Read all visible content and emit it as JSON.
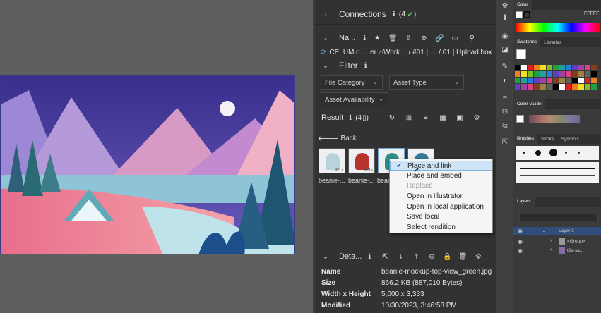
{
  "celum": {
    "connections_label": "Connections",
    "connections_count": "(4",
    "nav_label": "Na...",
    "breadcrumb": {
      "root": "CELUM d...",
      "suffix": "er",
      "workspace": "Work...",
      "p1": "/ #01 | ...",
      "p2": "/ 01 | Upload box"
    },
    "filter_label": "Filter",
    "filters": {
      "category": "File Category",
      "type": "Asset Type",
      "availability": "Asset Availability"
    },
    "result_label": "Result",
    "result_count": "(4",
    "back_label": "Back",
    "thumbs": [
      {
        "label": "beanie-...",
        "format": "JPG",
        "color": "#b9d3dc"
      },
      {
        "label": "beanie-...",
        "format": "JPG",
        "color": "#b8332c"
      },
      {
        "label": "bean",
        "format": "",
        "color": "#2e8d86"
      },
      {
        "label": "",
        "format": "",
        "color": "#347a98"
      }
    ],
    "context_menu": [
      {
        "label": "Place and link",
        "selected": true,
        "disabled": false
      },
      {
        "label": "Place and embed",
        "selected": false,
        "disabled": false
      },
      {
        "label": "Replace",
        "selected": false,
        "disabled": true
      },
      {
        "label": "Open in Illustrator",
        "selected": false,
        "disabled": false
      },
      {
        "label": "Open in local application",
        "selected": false,
        "disabled": false
      },
      {
        "label": "Save local",
        "selected": false,
        "disabled": false
      },
      {
        "label": "Select rendition",
        "selected": false,
        "disabled": false
      }
    ],
    "details_label": "Deta...",
    "details": [
      {
        "key": "Name",
        "value": "beanie-mockup-top-view_green.jpg"
      },
      {
        "key": "Size",
        "value": "866.2 KB (887,010 Bytes)"
      },
      {
        "key": "Width x Height",
        "value": "5,000 x 3,333"
      },
      {
        "key": "Modified",
        "value": "10/30/2023, 3:46:58 PM"
      }
    ]
  },
  "right_panel": {
    "color_title": "Color",
    "color_hex": "FFFFF",
    "tabs_swatches": [
      "Swatches",
      "Libraries"
    ],
    "color_guide": "Color Guide",
    "tabs_brushes": [
      "Brushes",
      "Stroke",
      "Symbols"
    ],
    "layers_title": "Layers",
    "layers": [
      {
        "name": "Layer 1"
      },
      {
        "name": "<Group>"
      },
      {
        "name": "t2v-sa..."
      }
    ]
  },
  "colors": {
    "accent": "#1a5fb0",
    "panel_bg": "#323232",
    "canvas_bg": "#5f5f5f"
  }
}
